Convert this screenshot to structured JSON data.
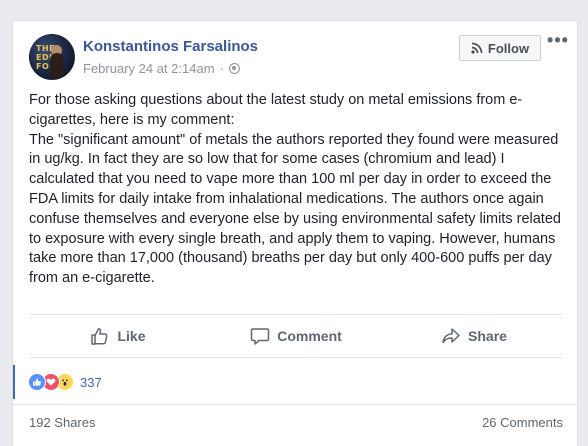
{
  "post": {
    "author": "Konstantinos Farsalinos",
    "timestamp": "February 24 at 2:14am",
    "separator": "·",
    "privacy_icon": "globe-icon",
    "follow_label": "Follow",
    "more_label": "•••",
    "avatar_text": "THE\nEDIA\nFORU",
    "body": "For those asking questions about the latest study on metal emissions from e-cigarettes, here is my comment:\nThe \"significant amount\" of metals the authors reported they found were measured in ug/kg. In fact they are so low that for some cases (chromium and lead) I calculated that you need to vape more than 100 ml per day in order to exceed the FDA limits for daily intake from inhalational medications. The authors once again confuse themselves and everyone else by using environmental safety limits related to exposure with every single breath, and apply them to vaping. However, humans take more than 17,000 (thousand) breaths per day but only 400-600 puffs per day from an e-cigarette."
  },
  "actions": {
    "like": "Like",
    "comment": "Comment",
    "share": "Share"
  },
  "reactions": {
    "types": [
      "like",
      "love",
      "wow"
    ],
    "count": "337"
  },
  "footer": {
    "shares": "192 Shares",
    "comments": "26 Comments"
  },
  "colors": {
    "link": "#385898",
    "accent": "#4267b2",
    "muted": "#606770"
  }
}
